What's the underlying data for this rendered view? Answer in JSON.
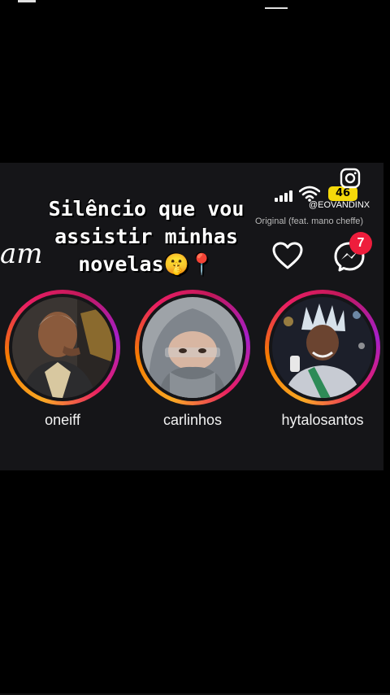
{
  "caption": {
    "line1": "Silêncio que vou",
    "line2": "assistir minhas",
    "line3": "novelas🤫📍"
  },
  "left_fragment": "am",
  "status": {
    "battery": "46"
  },
  "watermark": "@EOVANDINX",
  "music_text": "Original (feat. mano cheffe)",
  "icons": {
    "instagram": "instagram-icon",
    "heart": "heart-icon",
    "messenger": "messenger-icon",
    "signal": "signal-icon",
    "wifi": "wifi-icon"
  },
  "notifications": {
    "messenger_count": "7"
  },
  "stories": [
    {
      "username": "oneiff"
    },
    {
      "username": "carlinhos"
    },
    {
      "username": "hytalosantos"
    }
  ],
  "colors": {
    "panel_bg": "#151518",
    "badge": "#ee1d3c",
    "battery": "#f5d90a",
    "ring_start": "#f9a825",
    "ring_end": "#a61fc8"
  }
}
